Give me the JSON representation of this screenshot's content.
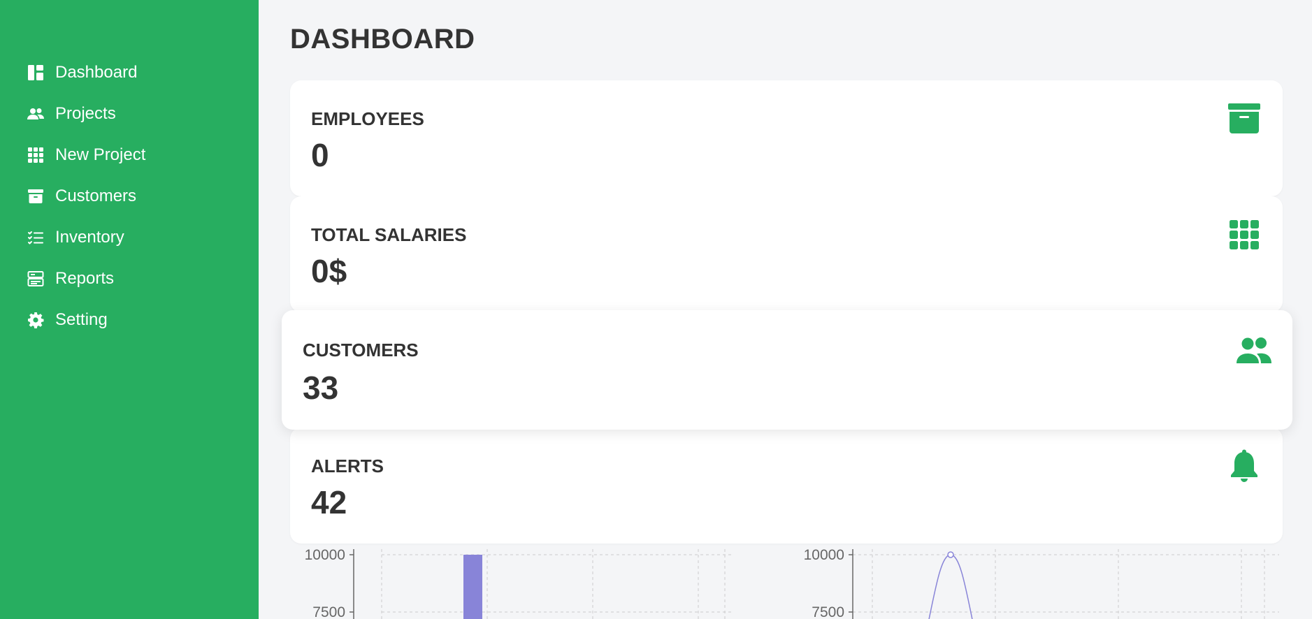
{
  "sidebar": {
    "items": [
      {
        "label": "Dashboard",
        "icon": "dashboard-icon"
      },
      {
        "label": "Projects",
        "icon": "users-icon"
      },
      {
        "label": "New Project",
        "icon": "grid-icon"
      },
      {
        "label": "Customers",
        "icon": "archive-icon"
      },
      {
        "label": "Inventory",
        "icon": "list-icon"
      },
      {
        "label": "Reports",
        "icon": "reports-icon"
      },
      {
        "label": "Setting",
        "icon": "gear-icon"
      }
    ]
  },
  "page": {
    "title": "DASHBOARD"
  },
  "cards": [
    {
      "label": "EMPLOYEES",
      "value": "0",
      "icon": "archive-icon"
    },
    {
      "label": "TOTAL SALARIES",
      "value": "0$",
      "icon": "grid-icon"
    },
    {
      "label": "CUSTOMERS",
      "value": "33",
      "icon": "users-icon"
    },
    {
      "label": "ALERTS",
      "value": "42",
      "icon": "bell-icon"
    }
  ],
  "colors": {
    "sidebar": "#27ae60",
    "accent": "#27ae60",
    "chart_series": "#8884d8",
    "text": "#333333"
  },
  "chart_data": [
    {
      "type": "bar",
      "y_ticks": [
        "10000",
        "7500"
      ],
      "ylim": [
        0,
        10000
      ],
      "series": [
        {
          "values": [
            10000
          ]
        }
      ]
    },
    {
      "type": "line",
      "y_ticks": [
        "10000",
        "7500"
      ],
      "ylim": [
        0,
        10000
      ],
      "series": [
        {
          "values": [
            10000
          ]
        }
      ]
    }
  ]
}
